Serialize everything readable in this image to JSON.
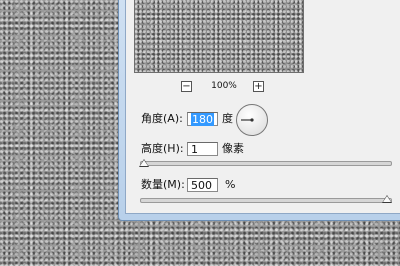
{
  "background": {
    "texture_icon": "embossed-noise-texture"
  },
  "preview": {
    "zoom_out_label": "−",
    "zoom_in_label": "+",
    "zoom_level": "100%"
  },
  "angle": {
    "label": "角度(A):",
    "value": "180",
    "unit": "度",
    "dial_icon": "angle-dial-icon"
  },
  "height": {
    "label": "高度(H):",
    "value": "1",
    "unit": "像素",
    "slider_fraction": 0.0
  },
  "amount": {
    "label": "数量(M):",
    "value": "500",
    "unit": "%",
    "slider_fraction": 1.0
  },
  "colors": {
    "selection": "#3399ff",
    "dialog_face": "#f0f0f0",
    "window_frame": "#b8d0ea"
  }
}
